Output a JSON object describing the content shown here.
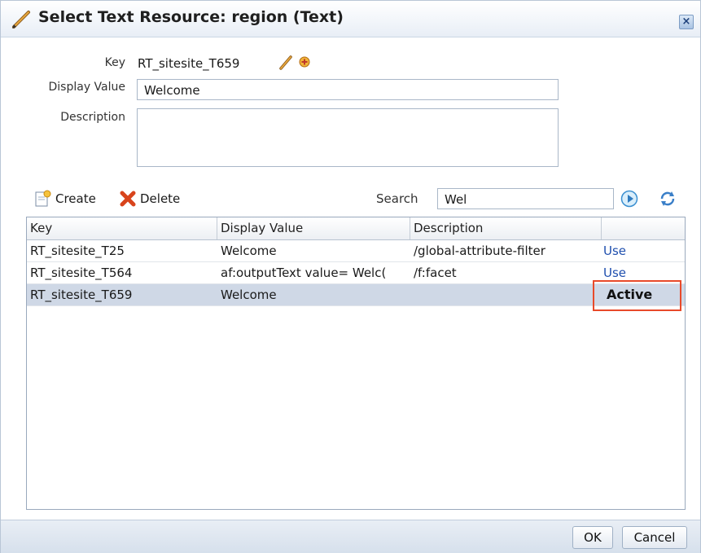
{
  "dialog": {
    "title": "Select Text Resource: region (Text)",
    "close_label": "×"
  },
  "form": {
    "key_label": "Key",
    "key_value": "RT_sitesite_T659",
    "display_value_label": "Display Value",
    "display_value": "Welcome",
    "description_label": "Description",
    "description_value": ""
  },
  "toolbar": {
    "create_label": "Create",
    "delete_label": "Delete",
    "search_label": "Search",
    "search_value": "Wel"
  },
  "grid": {
    "columns": [
      "Key",
      "Display Value",
      "Description",
      ""
    ],
    "rows": [
      {
        "key": "RT_sitesite_T25",
        "display_value": "Welcome",
        "description": "/global-attribute-filter",
        "action": "Use"
      },
      {
        "key": "RT_sitesite_T564",
        "display_value": "af:outputText value= Welc(",
        "description": "/f:facet",
        "action": "Use"
      },
      {
        "key": "RT_sitesite_T659",
        "display_value": "Welcome",
        "description": "",
        "action": "Active"
      }
    ],
    "selected_row": 2
  },
  "footer": {
    "ok_label": "OK",
    "cancel_label": "Cancel"
  },
  "colors": {
    "highlight_border": "#e84a2a",
    "link": "#1f4fae",
    "selected_row": "#cfd8e6"
  }
}
